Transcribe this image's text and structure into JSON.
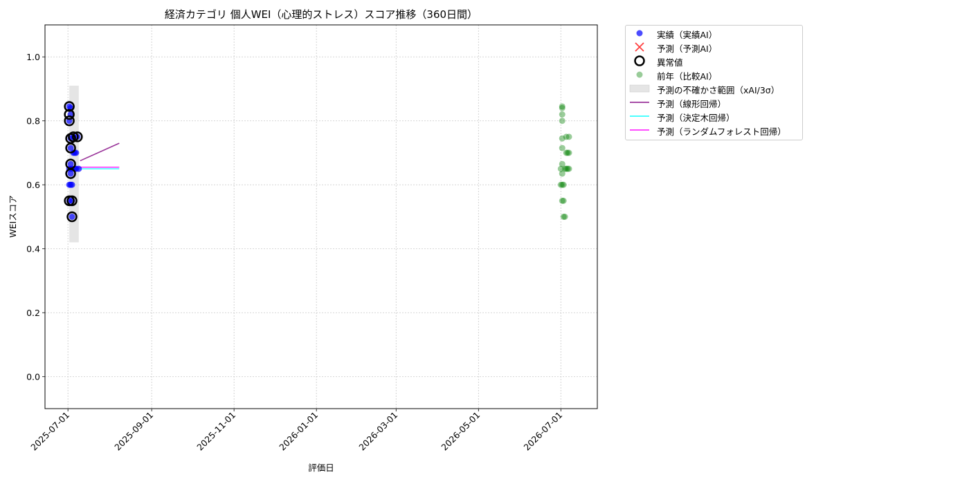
{
  "chart_data": {
    "type": "scatter",
    "title": "経済カテゴリ 個人WEI（心理的ストレス）スコア推移（360日間）",
    "xlabel": "評価日",
    "ylabel": "WEIスコア",
    "xlim": [
      "2025-06-14",
      "2026-07-28"
    ],
    "ylim": [
      -0.1,
      1.1
    ],
    "x_ticks": [
      "2025-07-01",
      "2025-09-01",
      "2025-11-01",
      "2026-01-01",
      "2026-03-01",
      "2026-05-01",
      "2026-07-01"
    ],
    "y_ticks": [
      0.0,
      0.2,
      0.4,
      0.6,
      0.8,
      1.0
    ],
    "grid": true,
    "legend_position": "outside-right-top",
    "colors": {
      "actual": "#0000ff",
      "forecast": "#ff0000",
      "anomaly": "#000000",
      "prev_year": "#008000",
      "uncertainty": "#d3d3d3",
      "linear": "#800080",
      "tree": "#00ffff",
      "forest": "#ff00ff"
    },
    "series": [
      {
        "name": "実績（実績AI）",
        "kind": "scatter",
        "points": [
          {
            "x": "2025-07-02",
            "y": 0.6
          },
          {
            "x": "2025-07-02",
            "y": 0.65
          },
          {
            "x": "2025-07-02",
            "y": 0.8
          },
          {
            "x": "2025-07-02",
            "y": 0.845
          },
          {
            "x": "2025-07-02",
            "y": 0.55
          },
          {
            "x": "2025-07-03",
            "y": 0.6
          },
          {
            "x": "2025-07-03",
            "y": 0.665
          },
          {
            "x": "2025-07-03",
            "y": 0.715
          },
          {
            "x": "2025-07-03",
            "y": 0.745
          },
          {
            "x": "2025-07-03",
            "y": 0.82
          },
          {
            "x": "2025-07-03",
            "y": 0.84
          },
          {
            "x": "2025-07-03",
            "y": 0.635
          },
          {
            "x": "2025-07-04",
            "y": 0.55
          },
          {
            "x": "2025-07-04",
            "y": 0.5
          },
          {
            "x": "2025-07-04",
            "y": 0.6
          },
          {
            "x": "2025-07-04",
            "y": 0.65
          },
          {
            "x": "2025-07-05",
            "y": 0.7
          },
          {
            "x": "2025-07-05",
            "y": 0.75
          },
          {
            "x": "2025-07-06",
            "y": 0.65
          },
          {
            "x": "2025-07-06",
            "y": 0.7
          },
          {
            "x": "2025-07-07",
            "y": 0.65
          },
          {
            "x": "2025-07-07",
            "y": 0.7
          },
          {
            "x": "2025-07-08",
            "y": 0.75
          },
          {
            "x": "2025-07-09",
            "y": 0.65
          }
        ]
      },
      {
        "name": "予測（予測AI）",
        "kind": "scatter",
        "points": []
      },
      {
        "name": "異常値",
        "kind": "scatter",
        "points": [
          {
            "x": "2025-07-02",
            "y": 0.845
          },
          {
            "x": "2025-07-02",
            "y": 0.82
          },
          {
            "x": "2025-07-02",
            "y": 0.8
          },
          {
            "x": "2025-07-02",
            "y": 0.55
          },
          {
            "x": "2025-07-03",
            "y": 0.745
          },
          {
            "x": "2025-07-03",
            "y": 0.715
          },
          {
            "x": "2025-07-03",
            "y": 0.665
          },
          {
            "x": "2025-07-03",
            "y": 0.635
          },
          {
            "x": "2025-07-04",
            "y": 0.55
          },
          {
            "x": "2025-07-04",
            "y": 0.5
          },
          {
            "x": "2025-07-05",
            "y": 0.75
          },
          {
            "x": "2025-07-08",
            "y": 0.75
          }
        ]
      },
      {
        "name": "前年（比較AI）",
        "kind": "scatter",
        "points": [
          {
            "x": "2026-07-01",
            "y": 0.6
          },
          {
            "x": "2026-07-01",
            "y": 0.65
          },
          {
            "x": "2026-07-02",
            "y": 0.6
          },
          {
            "x": "2026-07-02",
            "y": 0.8
          },
          {
            "x": "2026-07-02",
            "y": 0.845
          },
          {
            "x": "2026-07-02",
            "y": 0.55
          },
          {
            "x": "2026-07-02",
            "y": 0.665
          },
          {
            "x": "2026-07-02",
            "y": 0.715
          },
          {
            "x": "2026-07-02",
            "y": 0.745
          },
          {
            "x": "2026-07-02",
            "y": 0.82
          },
          {
            "x": "2026-07-02",
            "y": 0.84
          },
          {
            "x": "2026-07-02",
            "y": 0.635
          },
          {
            "x": "2026-07-03",
            "y": 0.6
          },
          {
            "x": "2026-07-03",
            "y": 0.55
          },
          {
            "x": "2026-07-03",
            "y": 0.5
          },
          {
            "x": "2026-07-04",
            "y": 0.5
          },
          {
            "x": "2026-07-04",
            "y": 0.65
          },
          {
            "x": "2026-07-05",
            "y": 0.65
          },
          {
            "x": "2026-07-05",
            "y": 0.7
          },
          {
            "x": "2026-07-05",
            "y": 0.75
          },
          {
            "x": "2026-07-06",
            "y": 0.65
          },
          {
            "x": "2026-07-06",
            "y": 0.7
          },
          {
            "x": "2026-07-07",
            "y": 0.75
          },
          {
            "x": "2026-07-07",
            "y": 0.65
          },
          {
            "x": "2026-07-07",
            "y": 0.7
          }
        ]
      },
      {
        "name": "予測の不確かさ範囲（xAI/3σ）",
        "kind": "band",
        "x": [
          "2025-07-02",
          "2025-07-09"
        ],
        "lower": 0.42,
        "upper": 0.91
      },
      {
        "name": "予測（線形回帰）",
        "kind": "line",
        "x": [
          "2025-07-10",
          "2025-08-08"
        ],
        "y": [
          0.675,
          0.73
        ]
      },
      {
        "name": "予測（決定木回帰）",
        "kind": "line",
        "x": [
          "2025-07-01",
          "2025-08-08"
        ],
        "y": [
          0.65,
          0.65
        ]
      },
      {
        "name": "予測（ランダムフォレスト回帰）",
        "kind": "line",
        "x": [
          "2025-07-01",
          "2025-08-08"
        ],
        "y": [
          0.655,
          0.655
        ]
      }
    ]
  }
}
